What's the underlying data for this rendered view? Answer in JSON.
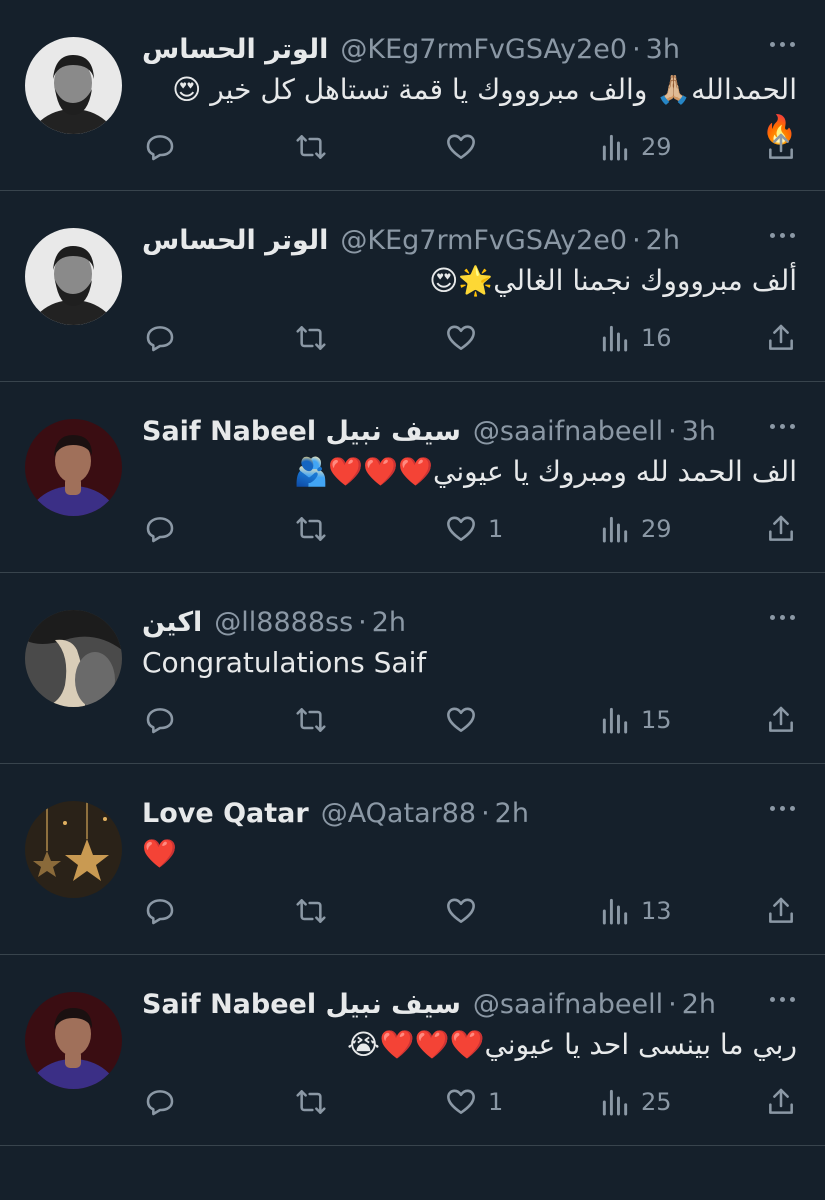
{
  "icons": {
    "reply": "reply-icon",
    "retweet": "retweet-icon",
    "like": "heart-icon",
    "views": "views-icon",
    "share": "share-icon",
    "more": "more-icon"
  },
  "tweets": [
    {
      "name": "الوتر الحساس",
      "handle": "@KEg7rmFvGSAy2e0",
      "time": "3h",
      "text": "الحمدالله🙏🏼 والف مبروووك يا قمة تستاهل كل خير 😍🔥",
      "likes": "",
      "views": "29"
    },
    {
      "name": "الوتر الحساس",
      "handle": "@KEg7rmFvGSAy2e0",
      "time": "2h",
      "text": "ألف مبروووك نجمنا الغالي🌟😍",
      "likes": "",
      "views": "16"
    },
    {
      "name": "Saif Nabeel سيف نبيل",
      "handle": "@saaifnabeell",
      "time": "3h",
      "text": "الف الحمد لله ومبروك يا عيوني❤️❤️❤️🫂",
      "likes": "1",
      "views": "29"
    },
    {
      "name": "اكين",
      "handle": "@ll8888ss",
      "time": "2h",
      "text": "Congratulations Saif",
      "likes": "",
      "views": "15"
    },
    {
      "name": "Love Qatar",
      "handle": "@AQatar88",
      "time": "2h",
      "text": "❤️",
      "likes": "",
      "views": "13"
    },
    {
      "name": "Saif Nabeel سيف نبيل",
      "handle": "@saaifnabeell",
      "time": "2h",
      "text": "ربي ما بينسى احد يا عيوني❤️❤️❤️😭",
      "likes": "1",
      "views": "25"
    }
  ]
}
